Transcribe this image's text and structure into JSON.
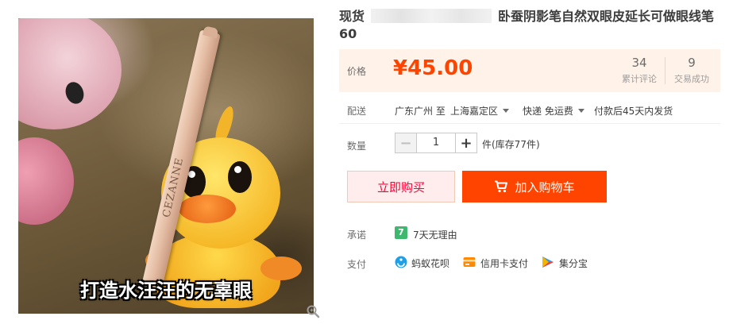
{
  "product": {
    "title_prefix": "现货",
    "title_suffix": "卧蚕阴影笔自然双眼皮延长可做眼线笔60",
    "image_caption": "打造水汪汪的无辜眼",
    "pencil_brand": "CEZANNE"
  },
  "price": {
    "label": "价格",
    "value": "¥45.00",
    "reviews_count": "34",
    "reviews_label": "累计评论",
    "trades_count": "9",
    "trades_label": "交易成功"
  },
  "shipping": {
    "label": "配送",
    "from": "广东广州 至",
    "to": "上海嘉定区",
    "method": "快递 免运费",
    "dispatch": "付款后45天内发货"
  },
  "quantity": {
    "label": "数量",
    "value": "1",
    "minus": "−",
    "plus": "+",
    "stock": "件(库存77件)"
  },
  "actions": {
    "buy_now": "立即购买",
    "add_to_cart": "加入购物车"
  },
  "promise": {
    "label": "承诺",
    "icon_text": "7",
    "text": "7天无理由"
  },
  "payment": {
    "label": "支付",
    "methods": [
      "蚂蚁花呗",
      "信用卡支付",
      "集分宝"
    ]
  },
  "colors": {
    "accent": "#ff4400",
    "price_bg": "#fff2e8",
    "buy_now_text": "#ff0036"
  },
  "icons": {
    "zoom": "magnifier-icon",
    "cart": "cart-icon",
    "promise": "seven-day-return-icon",
    "huabei": "huabei-icon",
    "credit_card": "credit-card-icon",
    "jifenbao": "jifenbao-icon"
  }
}
